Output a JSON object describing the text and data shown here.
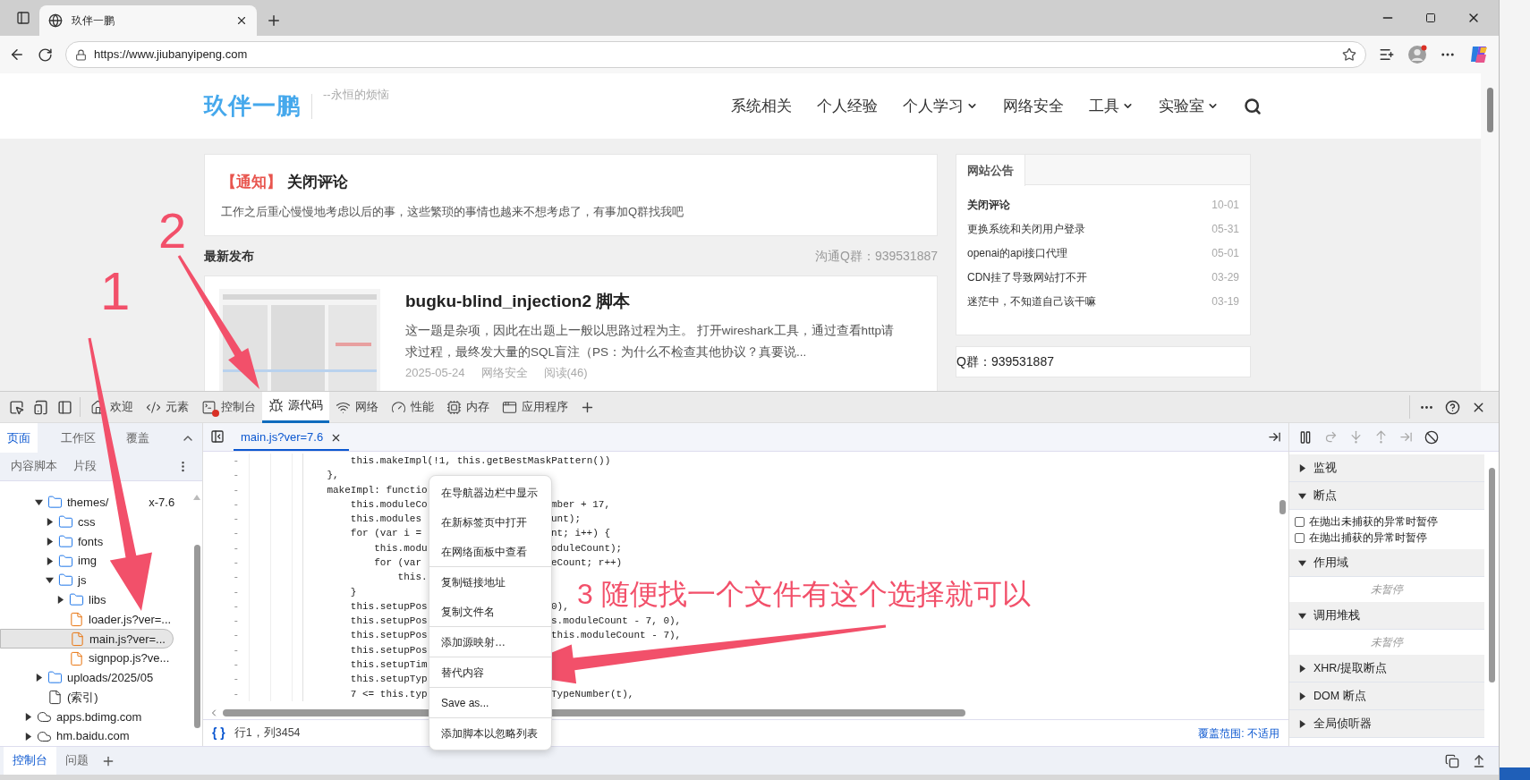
{
  "browser": {
    "tab_title": "玖伴一鹏",
    "url": "https://www.jiubanyipeng.com"
  },
  "site": {
    "logo": "玖伴一鹏",
    "tagline": "--永恒的烦恼",
    "nav": [
      {
        "label": "系统相关",
        "dropdown": false
      },
      {
        "label": "个人经验",
        "dropdown": false
      },
      {
        "label": "个人学习",
        "dropdown": true
      },
      {
        "label": "网络安全",
        "dropdown": false
      },
      {
        "label": "工具",
        "dropdown": true
      },
      {
        "label": "实验室",
        "dropdown": true
      }
    ],
    "notice": {
      "tag": "【通知】",
      "title": "关闭评论",
      "text": "工作之后重心慢慢地考虑以后的事，这些繁琐的事情也越来不想考虑了，有事加Q群找我吧"
    },
    "latest": {
      "heading": "最新发布",
      "qq": "沟通Q群：939531887"
    },
    "post": {
      "title": "bugku-blind_injection2 脚本",
      "excerpt": "这一题是杂项，因此在出题上一般以思路过程为主。 打开wireshark工具，通过查看http请求过程，最终发大量的SQL盲注（PS：为什么不检查其他协议？真要说...",
      "meta": [
        "2025-05-24",
        "网络安全",
        "阅读(46)"
      ]
    },
    "announcements": {
      "tab": "网站公告",
      "items": [
        {
          "title": "关闭评论",
          "date": "10-01",
          "bold": true
        },
        {
          "title": "更换系统和关闭用户登录",
          "date": "05-31",
          "bold": false
        },
        {
          "title": "openai的api接口代理",
          "date": "05-01",
          "bold": false
        },
        {
          "title": "CDN挂了导致网站打不开",
          "date": "03-29",
          "bold": false
        },
        {
          "title": "迷茫中，不知道自己该干嘛",
          "date": "03-19",
          "bold": false
        }
      ]
    },
    "qq_box": "Q群：939531887"
  },
  "devtools": {
    "tabs": [
      {
        "label": "欢迎",
        "selected": false
      },
      {
        "label": "元素",
        "selected": false
      },
      {
        "label": "控制台",
        "selected": false
      },
      {
        "label": "源代码",
        "selected": true
      },
      {
        "label": "网络",
        "selected": false
      },
      {
        "label": "性能",
        "selected": false
      },
      {
        "label": "内存",
        "selected": false
      },
      {
        "label": "应用程序",
        "selected": false
      }
    ],
    "nav_tabs": [
      {
        "label": "页面",
        "selected": true
      },
      {
        "label": "工作区",
        "selected": false
      },
      {
        "label": "覆盖",
        "selected": false
      }
    ],
    "nav_tabs_2": [
      "内容脚本",
      "片段"
    ],
    "tree": [
      {
        "kind": "continuation",
        "children": [
          {
            "kind": "folder",
            "label": "themes/",
            "label_tail": "x-7.6",
            "expanded": true,
            "selected": false,
            "children": [
              {
                "kind": "folder",
                "label": "css",
                "expanded": false,
                "selected": false
              },
              {
                "kind": "folder",
                "label": "fonts",
                "expanded": false,
                "selected": false
              },
              {
                "kind": "folder",
                "label": "img",
                "expanded": false,
                "selected": false
              },
              {
                "kind": "folder",
                "label": "js",
                "expanded": true,
                "selected": false,
                "children": [
                  {
                    "kind": "folder",
                    "label": "libs",
                    "expanded": false,
                    "selected": false
                  },
                  {
                    "kind": "script",
                    "label": "loader.js?ver=...",
                    "selected": false
                  },
                  {
                    "kind": "script",
                    "label": "main.js?ver=...",
                    "selected": true
                  },
                  {
                    "kind": "script",
                    "label": "signpop.js?ve...",
                    "selected": false
                  }
                ]
              }
            ]
          },
          {
            "kind": "folder",
            "label": "uploads/2025/05",
            "expanded": false,
            "selected": false
          },
          {
            "kind": "document",
            "label": "(索引)",
            "selected": false
          }
        ]
      },
      {
        "kind": "domain",
        "label": "apps.bdimg.com",
        "expanded": false,
        "selected": false
      },
      {
        "kind": "domain",
        "label": "hm.baidu.com",
        "expanded": false,
        "selected": false
      }
    ],
    "editor": {
      "file_tab": "main.js?ver=7.6",
      "lines": [
        {
          "num": "-",
          "left": "        this.makeImpl(!1, this.getBestMaskPattern())"
        },
        {
          "num": "-",
          "left": "    },"
        },
        {
          "num": "-",
          "left": "    makeImpl: functio"
        },
        {
          "num": "-",
          "left": "        this.moduleCo",
          "right": "mber + 17,"
        },
        {
          "num": "-",
          "left": "        this.modules ",
          "right": "unt);"
        },
        {
          "num": "-",
          "left": "        for (var i = ",
          "right": "nt; i++) {"
        },
        {
          "num": "-",
          "left": "            this.modu",
          "right": "oduleCount);"
        },
        {
          "num": "-",
          "left": "            for (var ",
          "right": "eCount; r++)"
        },
        {
          "num": "-",
          "left": "                this."
        },
        {
          "num": "-",
          "left": "        }"
        },
        {
          "num": "-",
          "left": "        this.setupPos",
          "right": "0),"
        },
        {
          "num": "-",
          "left": "        this.setupPos",
          "right": "s.moduleCount - 7, 0),"
        },
        {
          "num": "-",
          "left": "        this.setupPos",
          "right": "this.moduleCount - 7),"
        },
        {
          "num": "-",
          "left": "        this.setupPos"
        },
        {
          "num": "-",
          "left": "        this.setupTim"
        },
        {
          "num": "-",
          "left": "        this.setupTyp"
        },
        {
          "num": "-",
          "left": "        7 <= this.typ",
          "right": "TypeNumber(t),"
        }
      ],
      "format_button": "{ }",
      "position": "行1，列3454",
      "coverage": "覆盖范围: 不适用"
    },
    "context_menu": [
      [
        "在导航器边栏中显示",
        "在新标签页中打开",
        "在网络面板中查看"
      ],
      [
        "复制链接地址",
        "复制文件名"
      ],
      [
        "添加源映射…"
      ],
      [
        "替代内容"
      ],
      [
        "Save as..."
      ],
      [
        "添加脚本以忽略列表"
      ]
    ],
    "debugger": {
      "sections": [
        {
          "title": "监视",
          "expanded": false
        },
        {
          "title": "断点",
          "expanded": true,
          "kind": "checkboxes",
          "items": [
            {
              "label": "在抛出未捕获的异常时暂停",
              "checked": false
            },
            {
              "label": "在抛出捕获的异常时暂停",
              "checked": false
            }
          ]
        },
        {
          "title": "作用域",
          "expanded": true,
          "kind": "empty",
          "message": "未暂停"
        },
        {
          "title": "调用堆栈",
          "expanded": true,
          "kind": "empty",
          "message": "未暂停"
        },
        {
          "title": "XHR/提取断点",
          "expanded": false
        },
        {
          "title": "DOM 断点",
          "expanded": false
        },
        {
          "title": "全局侦听器",
          "expanded": false
        }
      ]
    },
    "drawer_tabs": [
      {
        "label": "控制台",
        "selected": true
      },
      {
        "label": "问题",
        "selected": false
      }
    ]
  },
  "annotations": [
    {
      "text": "1"
    },
    {
      "text": "2"
    },
    {
      "text": "3 随便找一个文件有这个选择就可以"
    }
  ]
}
